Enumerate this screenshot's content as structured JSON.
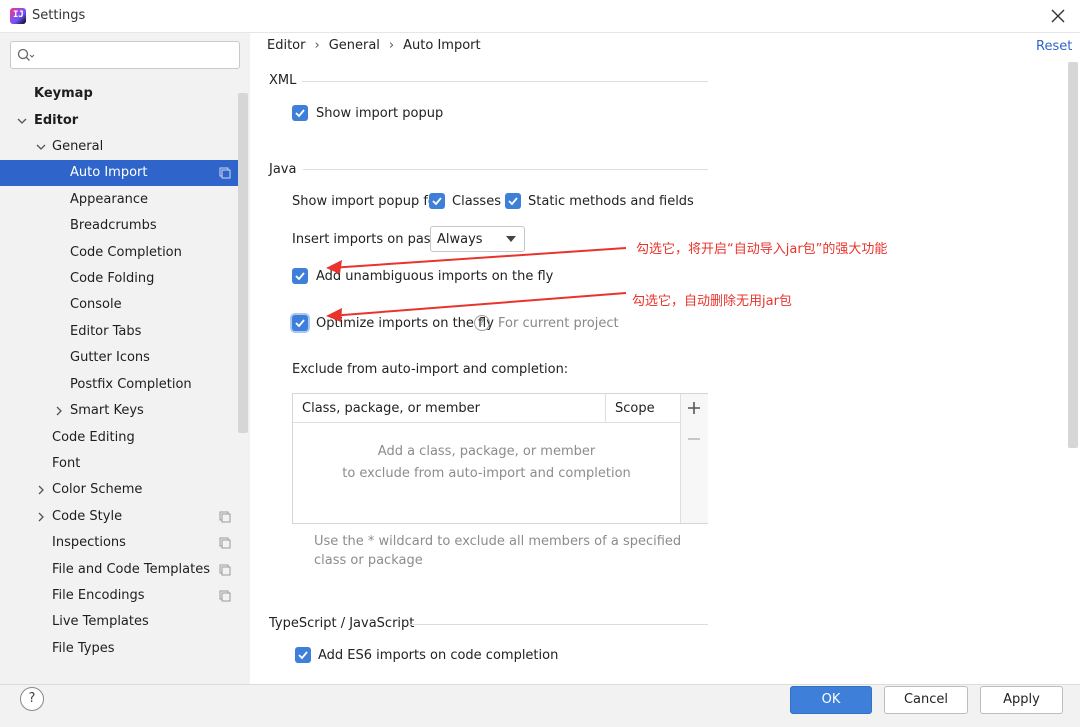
{
  "window": {
    "title": "Settings",
    "app_icon_text": "IJ"
  },
  "search": {
    "value": "",
    "placeholder": ""
  },
  "sidebar": {
    "items": [
      {
        "label": "Keymap"
      },
      {
        "label": "Editor"
      },
      {
        "label": "General"
      },
      {
        "label": "Auto Import"
      },
      {
        "label": "Appearance"
      },
      {
        "label": "Breadcrumbs"
      },
      {
        "label": "Code Completion"
      },
      {
        "label": "Code Folding"
      },
      {
        "label": "Console"
      },
      {
        "label": "Editor Tabs"
      },
      {
        "label": "Gutter Icons"
      },
      {
        "label": "Postfix Completion"
      },
      {
        "label": "Smart Keys"
      },
      {
        "label": "Code Editing"
      },
      {
        "label": "Font"
      },
      {
        "label": "Color Scheme"
      },
      {
        "label": "Code Style"
      },
      {
        "label": "Inspections"
      },
      {
        "label": "File and Code Templates"
      },
      {
        "label": "File Encodings"
      },
      {
        "label": "Live Templates"
      },
      {
        "label": "File Types"
      }
    ]
  },
  "breadcrumb": {
    "items": [
      "Editor",
      "General",
      "Auto Import"
    ],
    "separator": "›"
  },
  "reset_label": "Reset",
  "xml": {
    "title": "XML",
    "show_import_popup": "Show import popup"
  },
  "java": {
    "title": "Java",
    "show_popup_for": "Show import popup for:",
    "classes": "Classes",
    "static_methods": "Static methods and fields",
    "insert_imports": "Insert imports on paste:",
    "insert_imports_value": "Always",
    "add_unambiguous": "Add unambiguous imports on the fly",
    "optimize_imports": "Optimize imports on the fly",
    "for_current_project": "For current project",
    "help_glyph": "?",
    "exclude_title": "Exclude from auto-import and completion:",
    "table": {
      "columns": [
        "Class, package, or member",
        "Scope"
      ],
      "empty_line1": "Add a class, package, or member",
      "empty_line2": "to exclude from auto-import and completion"
    },
    "hint": "Use the * wildcard to exclude all members of a specified class or package"
  },
  "typescript": {
    "title": "TypeScript / JavaScript",
    "add_es6": "Add ES6 imports on code completion"
  },
  "annotations": {
    "first": "勾选它，将开启“自动导入jar包”的强大功能",
    "second": "勾选它，自动删除无用jar包"
  },
  "footer": {
    "help": "?",
    "ok": "OK",
    "cancel": "Cancel",
    "apply": "Apply"
  },
  "colors": {
    "accent": "#3d7fd9",
    "selection": "#2f65ca",
    "annotation": "#e8342d"
  }
}
